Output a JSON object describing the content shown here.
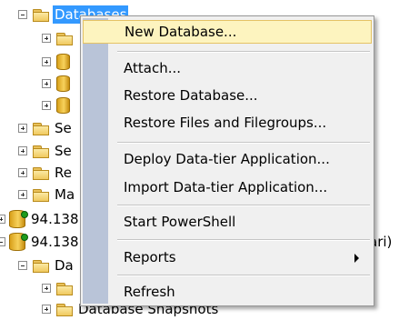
{
  "tree": {
    "databases_label": "Databases",
    "server_1_label": "94.138",
    "server_2_label": "94.138",
    "security_label_partial": "Se",
    "server_objects_label_partial": "Se",
    "replication_label_partial": "Re",
    "management_label_partial": "Ma",
    "databases_2_label_partial": "Da",
    "db_snapshots_label": "Database Snapshots",
    "server_2_suffix": "ari)"
  },
  "menu": {
    "items": [
      {
        "label": "New Database..."
      },
      {
        "label": "Attach..."
      },
      {
        "label": "Restore Database..."
      },
      {
        "label": "Restore Files and Filegroups..."
      },
      {
        "label": "Deploy Data-tier Application..."
      },
      {
        "label": "Import Data-tier Application..."
      },
      {
        "label": "Start PowerShell"
      },
      {
        "label": "Reports"
      },
      {
        "label": "Refresh"
      }
    ]
  },
  "colors": {
    "selection": "#3399ff",
    "menu_background": "#f0f0f0",
    "menu_gutter": "#b9c4d8",
    "hover_background": "#fdf4bf",
    "hover_border": "#e5c365"
  }
}
